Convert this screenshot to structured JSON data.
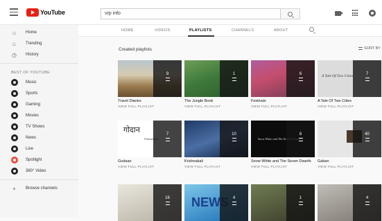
{
  "masthead": {
    "logo_text": "YouTube",
    "search_value": "vrp info"
  },
  "sidebar": {
    "main_items": [
      {
        "label": "Home",
        "icon": "home-icon"
      },
      {
        "label": "Trending",
        "icon": "trending-icon"
      },
      {
        "label": "History",
        "icon": "history-icon"
      }
    ],
    "section_title": "BEST OF YOUTUBE",
    "best_items": [
      {
        "label": "Music",
        "icon": "music-icon"
      },
      {
        "label": "Sports",
        "icon": "sports-icon"
      },
      {
        "label": "Gaming",
        "icon": "gaming-icon"
      },
      {
        "label": "Movies",
        "icon": "movies-icon"
      },
      {
        "label": "TV Shows",
        "icon": "tv-shows-icon"
      },
      {
        "label": "News",
        "icon": "news-icon"
      },
      {
        "label": "Live",
        "icon": "live-icon"
      },
      {
        "label": "Spotlight",
        "icon": "spotlight-icon"
      },
      {
        "label": "360° Video",
        "icon": "360-video-icon"
      }
    ],
    "browse_label": "Browse channels"
  },
  "tabs": [
    "HOME",
    "VIDEOS",
    "PLAYLISTS",
    "CHANNELS",
    "ABOUT"
  ],
  "active_tab": "PLAYLISTS",
  "shelf": {
    "title": "Created playlists",
    "sort_label": "SORT BY"
  },
  "view_link": "VIEW FULL PLAYLIST",
  "playlists": [
    {
      "title": "Travel Diaries",
      "count": "9"
    },
    {
      "title": "The Jungle Book",
      "count": "1"
    },
    {
      "title": "Festivals",
      "count": "6"
    },
    {
      "title": "A Tale Of Two Cities",
      "count": "7",
      "thumb_text": "A Tale Of Two Cities"
    },
    {
      "title": "Godaan",
      "count": "7",
      "thumb_text": "गोदान",
      "thumb_sub": "Premchand"
    },
    {
      "title": "Krishnakali",
      "count": "10"
    },
    {
      "title": "Snow White and The Seven Dwarfs",
      "count": "8",
      "thumb_text": "Snow White and The Seven Dwarfs"
    },
    {
      "title": "Gaban",
      "count": "40"
    },
    {
      "count": "16"
    },
    {
      "count": "4",
      "thumb_text": "NEWS"
    },
    {
      "count": "1"
    },
    {
      "count": "4"
    }
  ]
}
